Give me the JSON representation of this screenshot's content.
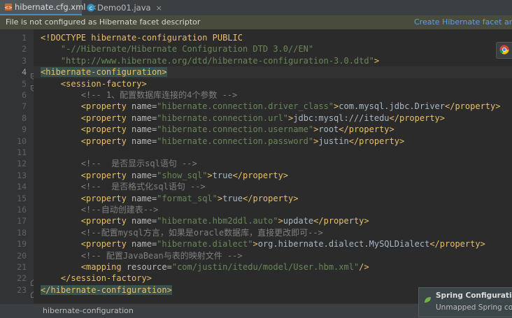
{
  "tabs": [
    {
      "label": "hibernate.cfg.xml",
      "icon": "xml-file-icon",
      "active": true
    },
    {
      "label": "Demo01.java",
      "icon": "java-class-icon",
      "active": false
    }
  ],
  "close_glyph": "×",
  "banner": {
    "message": "File is not configured as Hibernate facet descriptor",
    "action": "Create Hibernate facet and add"
  },
  "status": {
    "breadcrumb": "hibernate-configuration"
  },
  "notification": {
    "title": "Spring Configuration C",
    "body": "Unmapped Spring confi"
  },
  "current_line": 4,
  "editor": {
    "lines": [
      {
        "n": "1",
        "tokens": [
          {
            "t": "tg",
            "v": "<!DOCTYPE hibernate-configuration PUBLIC"
          }
        ]
      },
      {
        "n": "2",
        "tokens": [
          {
            "t": "sv",
            "v": "    \"-//Hibernate/Hibernate Configuration DTD 3.0//EN\""
          }
        ]
      },
      {
        "n": "3",
        "tokens": [
          {
            "t": "sv",
            "v": "    \"http://www.hibernate.org/dtd/hibernate-configuration-3.0.dtd\""
          },
          {
            "t": "tg",
            "v": ">"
          }
        ]
      },
      {
        "n": "4",
        "tokens": [
          {
            "t": "tg hl",
            "v": "<hibernate-configuration>"
          }
        ]
      },
      {
        "n": "5",
        "tokens": [
          {
            "t": "tx",
            "v": "    "
          },
          {
            "t": "tg",
            "v": "<session-factory>"
          }
        ]
      },
      {
        "n": "6",
        "tokens": [
          {
            "t": "cm",
            "v": "        <!-- 1、配置数据库连接的4个参数 -->"
          }
        ]
      },
      {
        "n": "7",
        "tokens": [
          {
            "t": "tx",
            "v": "        "
          },
          {
            "t": "tg",
            "v": "<property "
          },
          {
            "t": "at",
            "v": "name="
          },
          {
            "t": "sv",
            "v": "\"hibernate.connection.driver_class\""
          },
          {
            "t": "tg",
            "v": ">"
          },
          {
            "t": "tx",
            "v": "com.mysql.jdbc.Driver"
          },
          {
            "t": "tg",
            "v": "</property>"
          }
        ]
      },
      {
        "n": "8",
        "tokens": [
          {
            "t": "tx",
            "v": "        "
          },
          {
            "t": "tg",
            "v": "<property "
          },
          {
            "t": "at",
            "v": "name="
          },
          {
            "t": "sv",
            "v": "\"hibernate.connection.url\""
          },
          {
            "t": "tg",
            "v": ">"
          },
          {
            "t": "tx",
            "v": "jdbc:mysql:///itedu"
          },
          {
            "t": "tg",
            "v": "</property>"
          }
        ]
      },
      {
        "n": "9",
        "tokens": [
          {
            "t": "tx",
            "v": "        "
          },
          {
            "t": "tg",
            "v": "<property "
          },
          {
            "t": "at",
            "v": "name="
          },
          {
            "t": "sv",
            "v": "\"hibernate.connection.username\""
          },
          {
            "t": "tg",
            "v": ">"
          },
          {
            "t": "tx",
            "v": "root"
          },
          {
            "t": "tg",
            "v": "</property>"
          }
        ]
      },
      {
        "n": "10",
        "tokens": [
          {
            "t": "tx",
            "v": "        "
          },
          {
            "t": "tg",
            "v": "<property "
          },
          {
            "t": "at",
            "v": "name="
          },
          {
            "t": "sv",
            "v": "\"hibernate.connection.password\""
          },
          {
            "t": "tg",
            "v": ">"
          },
          {
            "t": "tx",
            "v": "justin"
          },
          {
            "t": "tg",
            "v": "</property>"
          }
        ]
      },
      {
        "n": "11",
        "tokens": []
      },
      {
        "n": "12",
        "tokens": [
          {
            "t": "cm",
            "v": "        <!--  是否显示sql语句 -->"
          }
        ]
      },
      {
        "n": "13",
        "tokens": [
          {
            "t": "tx",
            "v": "        "
          },
          {
            "t": "tg",
            "v": "<property "
          },
          {
            "t": "at",
            "v": "name="
          },
          {
            "t": "sv",
            "v": "\"show_sql\""
          },
          {
            "t": "tg",
            "v": ">"
          },
          {
            "t": "tx",
            "v": "true"
          },
          {
            "t": "tg",
            "v": "</property>"
          }
        ]
      },
      {
        "n": "14",
        "tokens": [
          {
            "t": "cm",
            "v": "        <!--  是否格式化sql语句 -->"
          }
        ]
      },
      {
        "n": "15",
        "tokens": [
          {
            "t": "tx",
            "v": "        "
          },
          {
            "t": "tg",
            "v": "<property "
          },
          {
            "t": "at",
            "v": "name="
          },
          {
            "t": "sv",
            "v": "\"format_sql\""
          },
          {
            "t": "tg",
            "v": ">"
          },
          {
            "t": "tx",
            "v": "true"
          },
          {
            "t": "tg",
            "v": "</property>"
          }
        ]
      },
      {
        "n": "16",
        "tokens": [
          {
            "t": "cm",
            "v": "        <!--自动创建表-->"
          }
        ]
      },
      {
        "n": "17",
        "tokens": [
          {
            "t": "tx",
            "v": "        "
          },
          {
            "t": "tg",
            "v": "<property "
          },
          {
            "t": "at",
            "v": "name="
          },
          {
            "t": "sv",
            "v": "\"hibernate.hbm2ddl.auto\""
          },
          {
            "t": "tg",
            "v": ">"
          },
          {
            "t": "tx",
            "v": "update"
          },
          {
            "t": "tg",
            "v": "</property>"
          }
        ]
      },
      {
        "n": "18",
        "tokens": [
          {
            "t": "cm",
            "v": "        <!--配置mysql方言，如果是oracle数据库，直接更改即可-->"
          }
        ]
      },
      {
        "n": "19",
        "tokens": [
          {
            "t": "tx",
            "v": "        "
          },
          {
            "t": "tg",
            "v": "<property "
          },
          {
            "t": "at",
            "v": "name="
          },
          {
            "t": "sv",
            "v": "\"hibernate.dialect\""
          },
          {
            "t": "tg",
            "v": ">"
          },
          {
            "t": "tx",
            "v": "org.hibernate.dialect.MySQLDialect"
          },
          {
            "t": "tg",
            "v": "</property>"
          }
        ]
      },
      {
        "n": "20",
        "tokens": [
          {
            "t": "cm",
            "v": "        <!-- 配置JavaBean与表的映射文件 -->"
          }
        ]
      },
      {
        "n": "21",
        "tokens": [
          {
            "t": "tx",
            "v": "        "
          },
          {
            "t": "tg",
            "v": "<mapping "
          },
          {
            "t": "at",
            "v": "resource="
          },
          {
            "t": "sv",
            "v": "\"com/justin/itedu/model/User.hbm.xml\""
          },
          {
            "t": "tg",
            "v": "/>"
          }
        ]
      },
      {
        "n": "22",
        "tokens": [
          {
            "t": "tx",
            "v": "    "
          },
          {
            "t": "tg",
            "v": "</session-factory>"
          }
        ]
      },
      {
        "n": "23",
        "tokens": [
          {
            "t": "tg hl",
            "v": "</hibernate-configuration>"
          }
        ]
      }
    ]
  },
  "folds": [
    4,
    5,
    22,
    23
  ]
}
